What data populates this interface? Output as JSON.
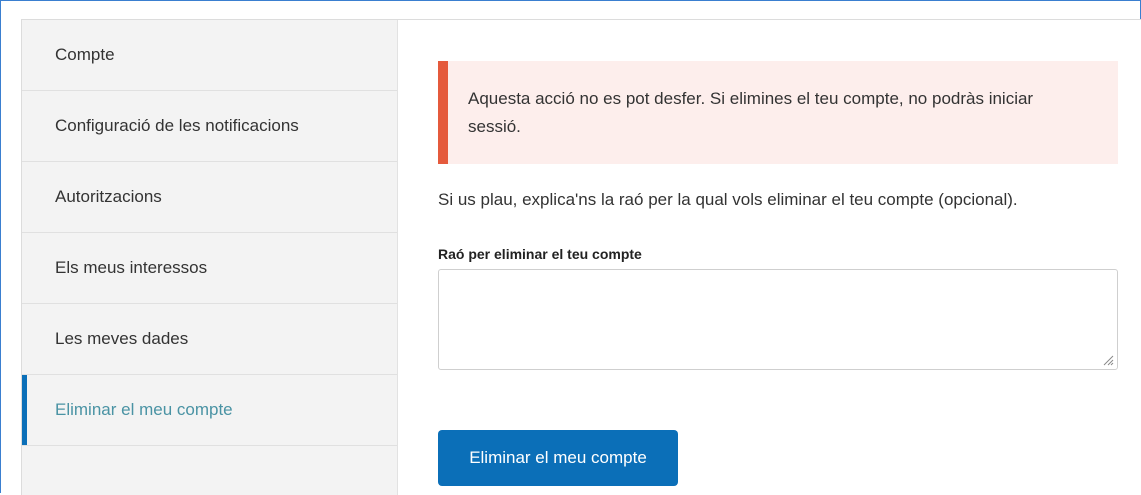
{
  "sidebar": {
    "items": [
      {
        "label": "Compte",
        "active": false
      },
      {
        "label": "Configuració de les notificacions",
        "active": false
      },
      {
        "label": "Autoritzacions",
        "active": false
      },
      {
        "label": "Els meus interessos",
        "active": false
      },
      {
        "label": "Les meves dades",
        "active": false
      },
      {
        "label": "Eliminar el meu compte",
        "active": true
      }
    ]
  },
  "main": {
    "alert_text": "Aquesta acció no es pot desfer. Si elimines el teu compte, no podràs iniciar sessió.",
    "intro_text": "Si us plau, explica'ns la raó per la qual vols eliminar el teu compte (opcional).",
    "reason_label": "Raó per eliminar el teu compte",
    "reason_value": "",
    "submit_label": "Eliminar el meu compte"
  },
  "colors": {
    "accent": "#0b6fb8",
    "active_text": "#4a93a4",
    "alert_border": "#e55a3c",
    "alert_bg": "#fdeeec"
  }
}
